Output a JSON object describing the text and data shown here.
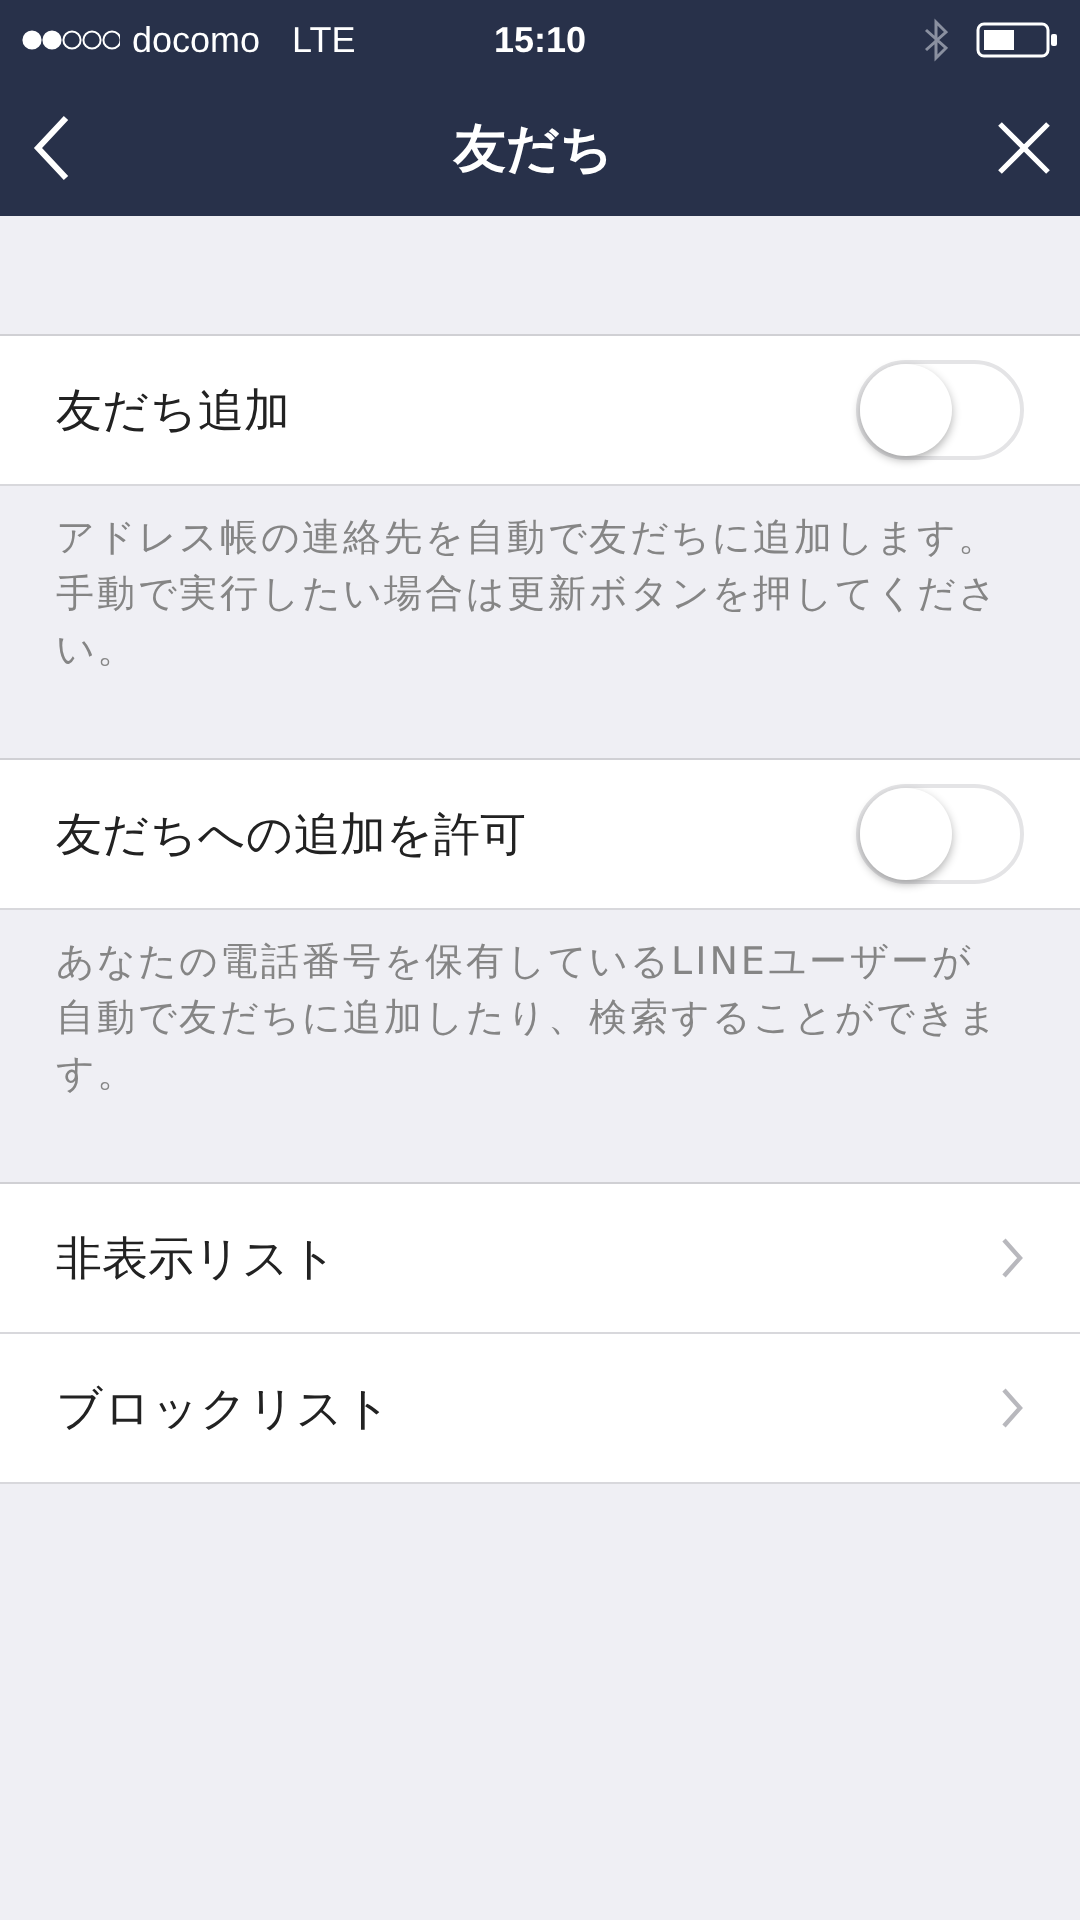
{
  "status_bar": {
    "carrier": "docomo",
    "network": "LTE",
    "time": "15:10"
  },
  "nav": {
    "title": "友だち"
  },
  "sections": [
    {
      "kind": "toggle",
      "label": "友だち追加",
      "on": false,
      "description": "アドレス帳の連絡先を自動で友だちに追加します。手動で実行したい場合は更新ボタンを押してください。"
    },
    {
      "kind": "toggle",
      "label": "友だちへの追加を許可",
      "on": false,
      "description": "あなたの電話番号を保有しているLINEユーザーが自動で友だちに追加したり、検索することができます。"
    }
  ],
  "links": [
    {
      "label": "非表示リスト"
    },
    {
      "label": "ブロックリスト"
    }
  ]
}
